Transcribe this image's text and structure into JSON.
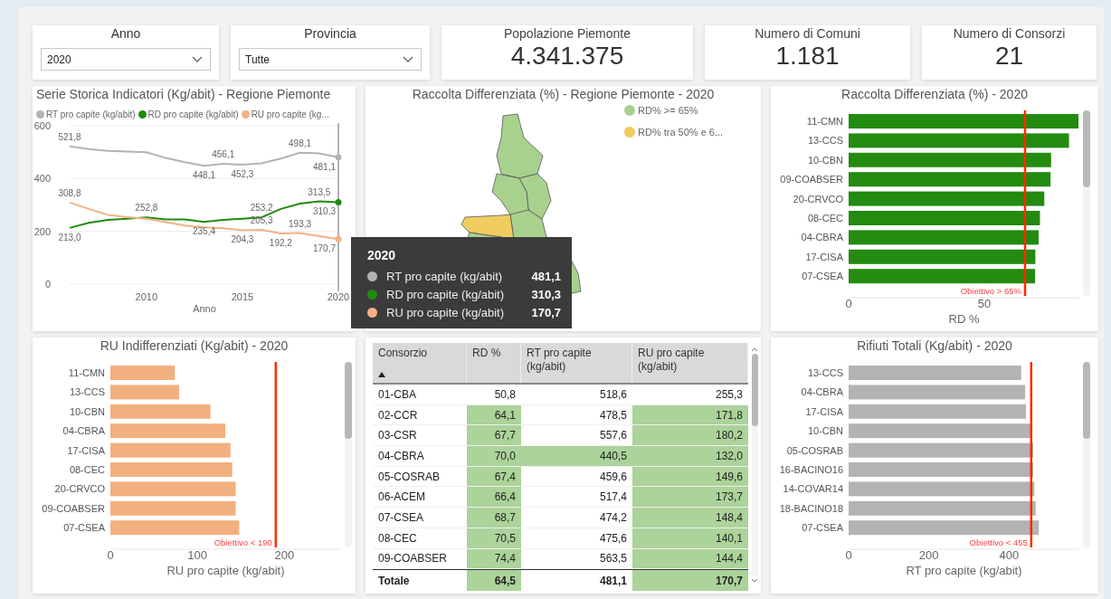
{
  "filters": [
    {
      "label": "Anno",
      "value": "2020"
    },
    {
      "label": "Provincia",
      "value": "Tutte"
    }
  ],
  "cards": [
    {
      "label": "Popolazione Piemonte",
      "value": "4.341.375"
    },
    {
      "label": "Numero di Comuni",
      "value": "1.181"
    },
    {
      "label": "Numero di Consorzi",
      "value": "21"
    }
  ],
  "panels": [
    {
      "kind": "chart",
      "title": "Serie Storica Indicatori (Kg/abit) - Regione Piemonte",
      "chart_data": {
        "type": "line",
        "xlabel": "Anno",
        "x": [
          2006,
          2007,
          2008,
          2009,
          2010,
          2011,
          2012,
          2013,
          2014,
          2015,
          2016,
          2017,
          2018,
          2019,
          2020
        ],
        "xlim": [
          2006,
          2020
        ],
        "ylim": [
          0,
          600
        ],
        "xticks": [
          2010,
          2015,
          2020
        ],
        "yticks": [
          0,
          200,
          400,
          600
        ],
        "series": [
          {
            "name": "RT pro capite (kg/abit)",
            "color": "#b3b3b3",
            "values": [
              521.8,
              512,
              505,
              502,
              500,
              478,
              462,
              448.1,
              456.1,
              452.3,
              458,
              476,
              498.1,
              495,
              481.1
            ],
            "value_labels": [
              "521,8",
              null,
              null,
              null,
              null,
              null,
              null,
              "448,1",
              "456,1",
              "452,3",
              null,
              null,
              "498,1",
              null,
              "481,1"
            ]
          },
          {
            "name": "RD pro capite (kg/abit)",
            "color": "#1f8c0e",
            "values": [
              213.0,
              232,
              243,
              248,
              252.8,
              245,
              245,
              235.4,
              243,
              248,
              253.2,
              285,
              305,
              313.5,
              310.3
            ],
            "value_labels": [
              "213,0",
              null,
              null,
              null,
              "252,8",
              null,
              null,
              "235,4",
              null,
              null,
              "253,2",
              null,
              null,
              "313,5",
              "310,3"
            ]
          },
          {
            "name": "RU pro capite (kg...",
            "color": "#f4b183",
            "values": [
              308.8,
              285,
              262,
              254,
              248,
              235,
              222,
              215,
              212,
              204.3,
              205.3,
              192.2,
              193.3,
              182,
              170.7
            ],
            "value_labels": [
              "308,8",
              null,
              null,
              null,
              null,
              null,
              null,
              null,
              null,
              "204,3",
              "205,3",
              "192,2",
              "193,3",
              null,
              "170,7"
            ]
          }
        ]
      }
    },
    {
      "kind": "map",
      "title": "Raccolta Differenziata (%) - Regione Piemonte - 2020",
      "legend": [
        {
          "label": "RD% >= 65%",
          "color": "#a9d18e"
        },
        {
          "label": "RD% tra 50% e 6...",
          "color": "#f0cb5e"
        }
      ]
    },
    {
      "kind": "chart",
      "title": "Raccolta Differenziata (%) - 2020",
      "chart_data": {
        "type": "bar",
        "orientation": "horizontal",
        "xlabel": "RD %",
        "categories": [
          "11-CMN",
          "13-CCS",
          "10-CBN",
          "09-COABSER",
          "20-CRVCO",
          "08-CEC",
          "04-CBRA",
          "17-CISA",
          "07-CSEA"
        ],
        "series": [
          {
            "color": "#228b10",
            "values": [
              84.7,
              81.2,
              74.6,
              74.4,
              72.1,
              70.5,
              70.0,
              68.8,
              68.7
            ]
          }
        ],
        "xlim": [
          0,
          85
        ],
        "xticks": [
          0,
          50
        ],
        "ref_lines": [
          {
            "axis": "x",
            "value": 65,
            "label": "Obiettivo > 65%"
          }
        ]
      }
    },
    {
      "kind": "chart",
      "title": "RU Indifferenziati (Kg/abit) - 2020",
      "chart_data": {
        "type": "bar",
        "orientation": "horizontal",
        "xlabel": "RU pro capite (kg/abit)",
        "categories": [
          "11-CMN",
          "13-CCS",
          "10-CBN",
          "04-CBRA",
          "17-CISA",
          "08-CEC",
          "20-CRVCO",
          "09-COABSER",
          "07-CSEA"
        ],
        "series": [
          {
            "color": "#f2b07f",
            "values": [
              74,
              79,
              115,
              132,
              138,
              140,
              144,
              144,
              148
            ]
          }
        ],
        "xlim": [
          0,
          265
        ],
        "xticks": [
          0,
          100,
          200
        ],
        "ref_lines": [
          {
            "axis": "x",
            "value": 190,
            "label": "Obiettivo < 190"
          }
        ]
      }
    },
    {
      "kind": "table",
      "columns": [
        {
          "label": "Consorzio",
          "sorted": true
        },
        {
          "label": "RD %",
          "sorted": false
        },
        {
          "label": "RT pro capite (kg/abit)",
          "sorted": false
        },
        {
          "label": "RU pro capite (kg/abit)",
          "sorted": false
        }
      ],
      "rows": [
        {
          "name": "01-CBA",
          "total": false,
          "cells": [
            {
              "text": "50,8",
              "highlight": false
            },
            {
              "text": "518,6",
              "highlight": false
            },
            {
              "text": "255,3",
              "highlight": false
            }
          ]
        },
        {
          "name": "02-CCR",
          "total": false,
          "cells": [
            {
              "text": "64,1",
              "highlight": true
            },
            {
              "text": "478,5",
              "highlight": false
            },
            {
              "text": "171,8",
              "highlight": true
            }
          ]
        },
        {
          "name": "03-CSR",
          "total": false,
          "cells": [
            {
              "text": "67,7",
              "highlight": true
            },
            {
              "text": "557,6",
              "highlight": false
            },
            {
              "text": "180,2",
              "highlight": true
            }
          ]
        },
        {
          "name": "04-CBRA",
          "total": false,
          "cells": [
            {
              "text": "70,0",
              "highlight": true
            },
            {
              "text": "440,5",
              "highlight": true
            },
            {
              "text": "132,0",
              "highlight": true
            }
          ]
        },
        {
          "name": "05-COSRAB",
          "total": false,
          "cells": [
            {
              "text": "67,4",
              "highlight": true
            },
            {
              "text": "459,6",
              "highlight": false
            },
            {
              "text": "149,6",
              "highlight": true
            }
          ]
        },
        {
          "name": "06-ACEM",
          "total": false,
          "cells": [
            {
              "text": "66,4",
              "highlight": true
            },
            {
              "text": "517,4",
              "highlight": false
            },
            {
              "text": "173,7",
              "highlight": true
            }
          ]
        },
        {
          "name": "07-CSEA",
          "total": false,
          "cells": [
            {
              "text": "68,7",
              "highlight": true
            },
            {
              "text": "474,2",
              "highlight": false
            },
            {
              "text": "148,4",
              "highlight": true
            }
          ]
        },
        {
          "name": "08-CEC",
          "total": false,
          "cells": [
            {
              "text": "70,5",
              "highlight": true
            },
            {
              "text": "475,6",
              "highlight": false
            },
            {
              "text": "140,1",
              "highlight": true
            }
          ]
        },
        {
          "name": "09-COABSER",
          "total": false,
          "cells": [
            {
              "text": "74,4",
              "highlight": true
            },
            {
              "text": "563,5",
              "highlight": false
            },
            {
              "text": "144,4",
              "highlight": true
            }
          ]
        },
        {
          "name": "Totale",
          "total": true,
          "cells": [
            {
              "text": "64,5",
              "highlight": true
            },
            {
              "text": "481,1",
              "highlight": false
            },
            {
              "text": "170,7",
              "highlight": true
            }
          ]
        }
      ]
    },
    {
      "kind": "chart",
      "title": "Rifiuti Totali (Kg/abit) - 2020",
      "chart_data": {
        "type": "bar",
        "orientation": "horizontal",
        "xlabel": "RT pro capite (kg/abit)",
        "categories": [
          "13-CCS",
          "04-CBRA",
          "17-CISA",
          "10-CBN",
          "05-COSRAB",
          "16-BACINO16",
          "14-COVAR14",
          "18-BACINO18",
          "07-CSEA"
        ],
        "series": [
          {
            "color": "#b3b3b3",
            "values": [
              430,
              440,
              442,
              458,
              460,
              460,
              463,
              466,
              474
            ]
          }
        ],
        "xlim": [
          0,
          575
        ],
        "xticks": [
          0,
          200,
          400
        ],
        "ref_lines": [
          {
            "axis": "x",
            "value": 455,
            "label": "Obiettivo < 455"
          }
        ]
      }
    }
  ],
  "tooltip": {
    "title": "2020",
    "items": [
      {
        "label": "RT pro capite (kg/abit)",
        "value": "481,1",
        "color": "#b3b3b3"
      },
      {
        "label": "RD pro capite (kg/abit)",
        "value": "310,3",
        "color": "#1f8c0e"
      },
      {
        "label": "RU pro capite (kg/abit)",
        "value": "170,7",
        "color": "#f4b183"
      }
    ]
  }
}
